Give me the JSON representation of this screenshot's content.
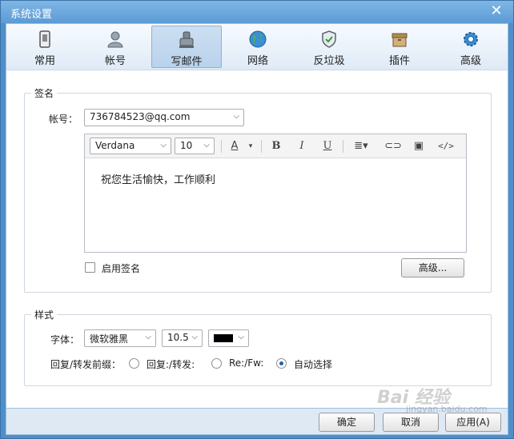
{
  "window": {
    "title": "系统设置"
  },
  "toolbar": {
    "items": [
      {
        "label": "常用",
        "icon": "general-icon"
      },
      {
        "label": "帐号",
        "icon": "account-icon"
      },
      {
        "label": "写邮件",
        "icon": "compose-icon",
        "active": true
      },
      {
        "label": "网络",
        "icon": "network-icon"
      },
      {
        "label": "反垃圾",
        "icon": "anti-spam-icon"
      },
      {
        "label": "插件",
        "icon": "plugin-icon"
      },
      {
        "label": "高级",
        "icon": "advanced-icon"
      }
    ]
  },
  "signature": {
    "group_label": "签名",
    "account_label": "帐号：",
    "account_value": "736784523@qq.com",
    "editor": {
      "font_family": "Verdana",
      "font_size": "10",
      "bold": "B",
      "italic": "I",
      "underline": "U",
      "text": "祝您生活愉快，工作顺利"
    },
    "enable_label": "启用签名",
    "enabled": false,
    "advanced_button": "高级..."
  },
  "style": {
    "group_label": "样式",
    "font_label": "字体：",
    "font_value": "微软雅黑",
    "size_value": "10.5",
    "color_value": "#000000",
    "prefix_label": "回复/转发前缀：",
    "options": [
      {
        "label": "回复:/转发:",
        "selected": false
      },
      {
        "label": "Re:/Fw:",
        "selected": false
      },
      {
        "label": "自动选择",
        "selected": true
      }
    ]
  },
  "footer": {
    "ok": "确定",
    "cancel": "取消",
    "apply": "应用(A)"
  },
  "watermark": {
    "text": "Bai 经验",
    "sub": "jingyan.baidu.com"
  }
}
